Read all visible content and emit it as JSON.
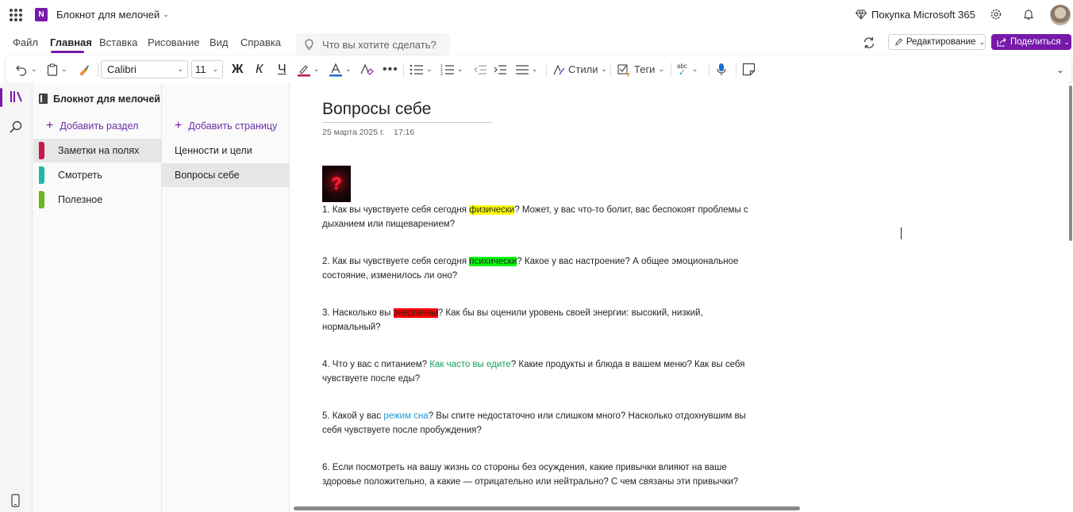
{
  "app": {
    "notebook_title": "Блокнот для мелочей",
    "upgrade_label": "Покупка Microsoft 365"
  },
  "menu": {
    "items": [
      "Файл",
      "Главная",
      "Вставка",
      "Рисование",
      "Вид",
      "Справка"
    ],
    "active": "Главная",
    "search_placeholder": "Что вы хотите сделать?",
    "edit_mode_label": "Редактирование",
    "share_label": "Поделиться"
  },
  "ribbon": {
    "font_name": "Calibri",
    "font_size": "11",
    "bold_glyph": "Ж",
    "italic_glyph": "К",
    "underline_glyph": "Ч",
    "styles_label": "Стили",
    "tags_label": "Теги",
    "spell_label": "abc"
  },
  "sections_panel": {
    "notebook_label": "Блокнот для мелочей",
    "add_section_label": "Добавить раздел",
    "sections": [
      {
        "label": "Заметки на полях",
        "color": "#c6184a",
        "selected": true
      },
      {
        "label": "Смотреть",
        "color": "#1fb7a6",
        "selected": false
      },
      {
        "label": "Полезное",
        "color": "#6cb61f",
        "selected": false
      }
    ]
  },
  "pages_panel": {
    "add_page_label": "Добавить страницу",
    "pages": [
      {
        "label": "Ценности и цели",
        "selected": false
      },
      {
        "label": "Вопросы себе",
        "selected": true
      }
    ]
  },
  "page": {
    "title": "Вопросы себе",
    "date": "25 марта 2025 г.",
    "time": "17:16",
    "paragraphs": [
      {
        "pre": "1. Как вы чувствуете себя сегодня ",
        "mark": "физически",
        "post": "? Может, у вас что-то болит, вас беспокоят проблемы с дыханием или пищеварением?"
      },
      {
        "pre": "2. Как вы чувствуете себя сегодня ",
        "mark": "психически",
        "post": "? Какое у вас настроение? А общее эмоциональное состояние, изменилось ли оно?"
      },
      {
        "pre": "3. Насколько вы ",
        "mark": "энергичны",
        "post": "? Как бы вы оценили уровень своей энергии: высокий, низкий, нормальный?"
      },
      {
        "pre": "4. Что у вас с питанием? ",
        "mark": "Как часто вы едите",
        "post": "? Какие продукты и блюда в вашем меню? Как вы себя чувствуете после еды?"
      },
      {
        "pre": "5. Какой у вас ",
        "mark": "режим сна",
        "post": "? Вы спите недостаточно или слишком много? Насколько отдохнувшим вы себя чувствуете после пробуждения?"
      },
      {
        "pre": "6. Если посмотреть на вашу жизнь со стороны без осуждения, какие привычки влияют на ваше здоровье положительно, а какие — отрицательно или нейтрально? С чем связаны эти привычки?",
        "mark": "",
        "post": ""
      }
    ]
  },
  "colors": {
    "accent": "#7719aa",
    "highlight_yellow": "#ffff00",
    "highlight_green": "#00ff00",
    "highlight_red": "#ff0000",
    "font_green": "#16a05c",
    "font_blue": "#1b9bd1"
  },
  "icons": [
    "app-launcher-icon",
    "onenote-icon",
    "diamond-icon",
    "gear-icon",
    "bell-icon",
    "lightbulb-icon",
    "sync-icon",
    "pencil-icon",
    "share-icon",
    "undo-icon",
    "clipboard-icon",
    "format-painter-icon",
    "highlighter-icon",
    "font-color-icon",
    "clear-format-icon",
    "more-icon",
    "bullets-icon",
    "numbering-icon",
    "outdent-icon",
    "indent-icon",
    "align-icon",
    "styles-icon",
    "tag-icon",
    "spellcheck-icon",
    "microphone-icon",
    "sticky-note-icon",
    "notebooks-icon",
    "search-icon",
    "device-icon"
  ]
}
